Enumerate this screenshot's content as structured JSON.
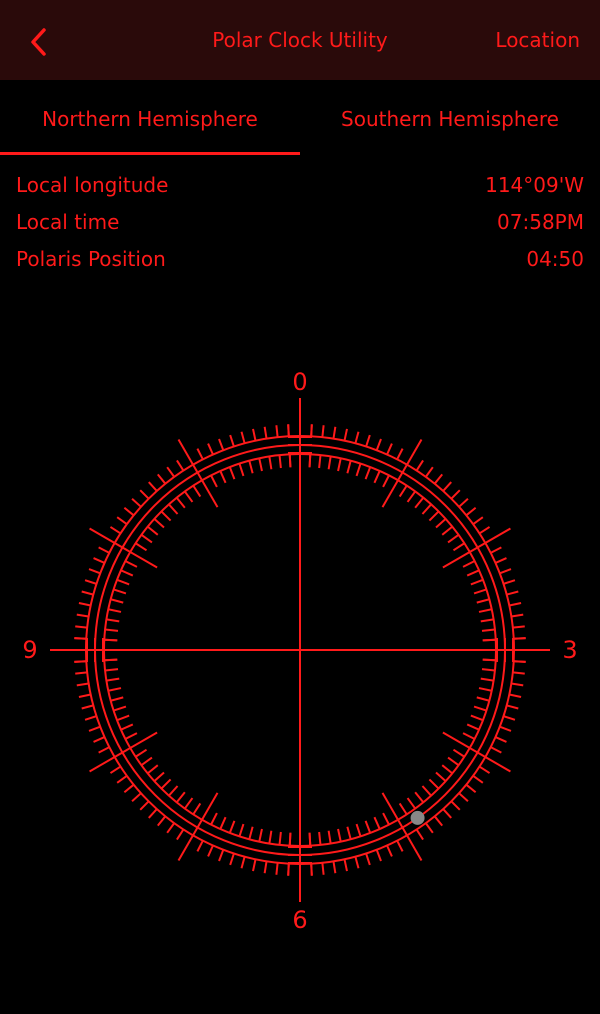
{
  "navbar": {
    "title": "Polar Clock Utility",
    "location_label": "Location",
    "back_icon": "chevron-left-icon"
  },
  "tabs": [
    {
      "label": "Northern Hemisphere",
      "selected": true
    },
    {
      "label": "Southern Hemisphere",
      "selected": false
    }
  ],
  "info": [
    {
      "label": "Local longitude",
      "value": "114°09'W"
    },
    {
      "label": "Local time",
      "value": "07:58PM"
    },
    {
      "label": "Polaris Position",
      "value": "04:50"
    }
  ],
  "dial": {
    "labels": {
      "top": "0",
      "right": "3",
      "bottom": "6",
      "left": "9"
    },
    "polaris_marker_color": "#888888"
  },
  "colors": {
    "accent": "#ff1a1a",
    "navbar_bg": "#2a0a0a",
    "background": "#000000"
  }
}
